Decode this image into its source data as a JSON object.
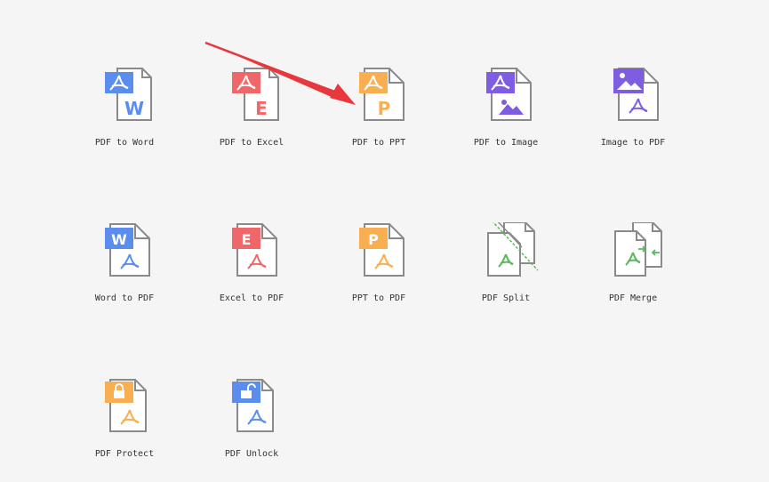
{
  "colors": {
    "word": "#5b8def",
    "excel": "#f0676a",
    "ppt": "#f9ae52",
    "image": "#7e5de3",
    "split": "#5cb85c",
    "merge": "#5cb85c",
    "outline": "#8a8a8a",
    "annotation_arrow": "#e8383d"
  },
  "tools": [
    {
      "id": "pdf-to-word",
      "label": "PDF to Word",
      "icon": "pdf-to-word-icon"
    },
    {
      "id": "pdf-to-excel",
      "label": "PDF to Excel",
      "icon": "pdf-to-excel-icon"
    },
    {
      "id": "pdf-to-ppt",
      "label": "PDF to PPT",
      "icon": "pdf-to-ppt-icon"
    },
    {
      "id": "pdf-to-image",
      "label": "PDF to Image",
      "icon": "pdf-to-image-icon"
    },
    {
      "id": "image-to-pdf",
      "label": "Image to PDF",
      "icon": "image-to-pdf-icon"
    },
    {
      "id": "word-to-pdf",
      "label": "Word to PDF",
      "icon": "word-to-pdf-icon"
    },
    {
      "id": "excel-to-pdf",
      "label": "Excel to PDF",
      "icon": "excel-to-pdf-icon"
    },
    {
      "id": "ppt-to-pdf",
      "label": "PPT to PDF",
      "icon": "ppt-to-pdf-icon"
    },
    {
      "id": "pdf-split",
      "label": "PDF Split",
      "icon": "pdf-split-icon"
    },
    {
      "id": "pdf-merge",
      "label": "PDF Merge",
      "icon": "pdf-merge-icon"
    },
    {
      "id": "pdf-protect",
      "label": "PDF Protect",
      "icon": "pdf-protect-icon"
    },
    {
      "id": "pdf-unlock",
      "label": "PDF Unlock",
      "icon": "pdf-unlock-icon"
    }
  ],
  "badge_letters": {
    "pdf_to_word": "W",
    "pdf_to_excel": "E",
    "pdf_to_ppt": "P",
    "word_to_pdf": "W",
    "excel_to_pdf": "E",
    "ppt_to_pdf": "P"
  }
}
